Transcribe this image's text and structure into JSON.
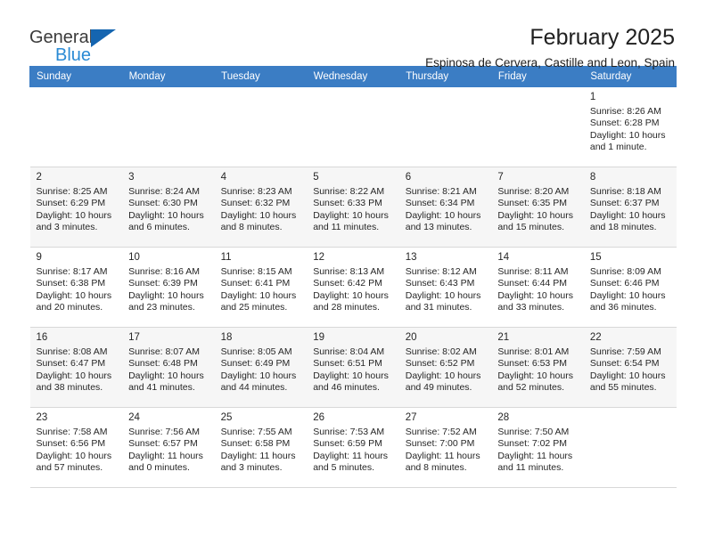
{
  "brand": {
    "line1": "General",
    "line2": "Blue",
    "triangle_color": "#1565b0",
    "blue_color": "#2a8ad4"
  },
  "header": {
    "title": "February 2025",
    "subtitle": "Espinosa de Cervera, Castille and Leon, Spain",
    "header_bg": "#3b7dc4",
    "alt_row_bg": "#f6f6f6"
  },
  "weekday_headers": [
    "Sunday",
    "Monday",
    "Tuesday",
    "Wednesday",
    "Thursday",
    "Friday",
    "Saturday"
  ],
  "weeks": [
    {
      "days": [
        {
          "num": "",
          "sunrise": "",
          "sunset": "",
          "daylight1": "",
          "daylight2": ""
        },
        {
          "num": "",
          "sunrise": "",
          "sunset": "",
          "daylight1": "",
          "daylight2": ""
        },
        {
          "num": "",
          "sunrise": "",
          "sunset": "",
          "daylight1": "",
          "daylight2": ""
        },
        {
          "num": "",
          "sunrise": "",
          "sunset": "",
          "daylight1": "",
          "daylight2": ""
        },
        {
          "num": "",
          "sunrise": "",
          "sunset": "",
          "daylight1": "",
          "daylight2": ""
        },
        {
          "num": "",
          "sunrise": "",
          "sunset": "",
          "daylight1": "",
          "daylight2": ""
        },
        {
          "num": "1",
          "sunrise": "Sunrise: 8:26 AM",
          "sunset": "Sunset: 6:28 PM",
          "daylight1": "Daylight: 10 hours",
          "daylight2": "and 1 minute."
        }
      ]
    },
    {
      "days": [
        {
          "num": "2",
          "sunrise": "Sunrise: 8:25 AM",
          "sunset": "Sunset: 6:29 PM",
          "daylight1": "Daylight: 10 hours",
          "daylight2": "and 3 minutes."
        },
        {
          "num": "3",
          "sunrise": "Sunrise: 8:24 AM",
          "sunset": "Sunset: 6:30 PM",
          "daylight1": "Daylight: 10 hours",
          "daylight2": "and 6 minutes."
        },
        {
          "num": "4",
          "sunrise": "Sunrise: 8:23 AM",
          "sunset": "Sunset: 6:32 PM",
          "daylight1": "Daylight: 10 hours",
          "daylight2": "and 8 minutes."
        },
        {
          "num": "5",
          "sunrise": "Sunrise: 8:22 AM",
          "sunset": "Sunset: 6:33 PM",
          "daylight1": "Daylight: 10 hours",
          "daylight2": "and 11 minutes."
        },
        {
          "num": "6",
          "sunrise": "Sunrise: 8:21 AM",
          "sunset": "Sunset: 6:34 PM",
          "daylight1": "Daylight: 10 hours",
          "daylight2": "and 13 minutes."
        },
        {
          "num": "7",
          "sunrise": "Sunrise: 8:20 AM",
          "sunset": "Sunset: 6:35 PM",
          "daylight1": "Daylight: 10 hours",
          "daylight2": "and 15 minutes."
        },
        {
          "num": "8",
          "sunrise": "Sunrise: 8:18 AM",
          "sunset": "Sunset: 6:37 PM",
          "daylight1": "Daylight: 10 hours",
          "daylight2": "and 18 minutes."
        }
      ]
    },
    {
      "days": [
        {
          "num": "9",
          "sunrise": "Sunrise: 8:17 AM",
          "sunset": "Sunset: 6:38 PM",
          "daylight1": "Daylight: 10 hours",
          "daylight2": "and 20 minutes."
        },
        {
          "num": "10",
          "sunrise": "Sunrise: 8:16 AM",
          "sunset": "Sunset: 6:39 PM",
          "daylight1": "Daylight: 10 hours",
          "daylight2": "and 23 minutes."
        },
        {
          "num": "11",
          "sunrise": "Sunrise: 8:15 AM",
          "sunset": "Sunset: 6:41 PM",
          "daylight1": "Daylight: 10 hours",
          "daylight2": "and 25 minutes."
        },
        {
          "num": "12",
          "sunrise": "Sunrise: 8:13 AM",
          "sunset": "Sunset: 6:42 PM",
          "daylight1": "Daylight: 10 hours",
          "daylight2": "and 28 minutes."
        },
        {
          "num": "13",
          "sunrise": "Sunrise: 8:12 AM",
          "sunset": "Sunset: 6:43 PM",
          "daylight1": "Daylight: 10 hours",
          "daylight2": "and 31 minutes."
        },
        {
          "num": "14",
          "sunrise": "Sunrise: 8:11 AM",
          "sunset": "Sunset: 6:44 PM",
          "daylight1": "Daylight: 10 hours",
          "daylight2": "and 33 minutes."
        },
        {
          "num": "15",
          "sunrise": "Sunrise: 8:09 AM",
          "sunset": "Sunset: 6:46 PM",
          "daylight1": "Daylight: 10 hours",
          "daylight2": "and 36 minutes."
        }
      ]
    },
    {
      "days": [
        {
          "num": "16",
          "sunrise": "Sunrise: 8:08 AM",
          "sunset": "Sunset: 6:47 PM",
          "daylight1": "Daylight: 10 hours",
          "daylight2": "and 38 minutes."
        },
        {
          "num": "17",
          "sunrise": "Sunrise: 8:07 AM",
          "sunset": "Sunset: 6:48 PM",
          "daylight1": "Daylight: 10 hours",
          "daylight2": "and 41 minutes."
        },
        {
          "num": "18",
          "sunrise": "Sunrise: 8:05 AM",
          "sunset": "Sunset: 6:49 PM",
          "daylight1": "Daylight: 10 hours",
          "daylight2": "and 44 minutes."
        },
        {
          "num": "19",
          "sunrise": "Sunrise: 8:04 AM",
          "sunset": "Sunset: 6:51 PM",
          "daylight1": "Daylight: 10 hours",
          "daylight2": "and 46 minutes."
        },
        {
          "num": "20",
          "sunrise": "Sunrise: 8:02 AM",
          "sunset": "Sunset: 6:52 PM",
          "daylight1": "Daylight: 10 hours",
          "daylight2": "and 49 minutes."
        },
        {
          "num": "21",
          "sunrise": "Sunrise: 8:01 AM",
          "sunset": "Sunset: 6:53 PM",
          "daylight1": "Daylight: 10 hours",
          "daylight2": "and 52 minutes."
        },
        {
          "num": "22",
          "sunrise": "Sunrise: 7:59 AM",
          "sunset": "Sunset: 6:54 PM",
          "daylight1": "Daylight: 10 hours",
          "daylight2": "and 55 minutes."
        }
      ]
    },
    {
      "days": [
        {
          "num": "23",
          "sunrise": "Sunrise: 7:58 AM",
          "sunset": "Sunset: 6:56 PM",
          "daylight1": "Daylight: 10 hours",
          "daylight2": "and 57 minutes."
        },
        {
          "num": "24",
          "sunrise": "Sunrise: 7:56 AM",
          "sunset": "Sunset: 6:57 PM",
          "daylight1": "Daylight: 11 hours",
          "daylight2": "and 0 minutes."
        },
        {
          "num": "25",
          "sunrise": "Sunrise: 7:55 AM",
          "sunset": "Sunset: 6:58 PM",
          "daylight1": "Daylight: 11 hours",
          "daylight2": "and 3 minutes."
        },
        {
          "num": "26",
          "sunrise": "Sunrise: 7:53 AM",
          "sunset": "Sunset: 6:59 PM",
          "daylight1": "Daylight: 11 hours",
          "daylight2": "and 5 minutes."
        },
        {
          "num": "27",
          "sunrise": "Sunrise: 7:52 AM",
          "sunset": "Sunset: 7:00 PM",
          "daylight1": "Daylight: 11 hours",
          "daylight2": "and 8 minutes."
        },
        {
          "num": "28",
          "sunrise": "Sunrise: 7:50 AM",
          "sunset": "Sunset: 7:02 PM",
          "daylight1": "Daylight: 11 hours",
          "daylight2": "and 11 minutes."
        },
        {
          "num": "",
          "sunrise": "",
          "sunset": "",
          "daylight1": "",
          "daylight2": ""
        }
      ]
    }
  ]
}
